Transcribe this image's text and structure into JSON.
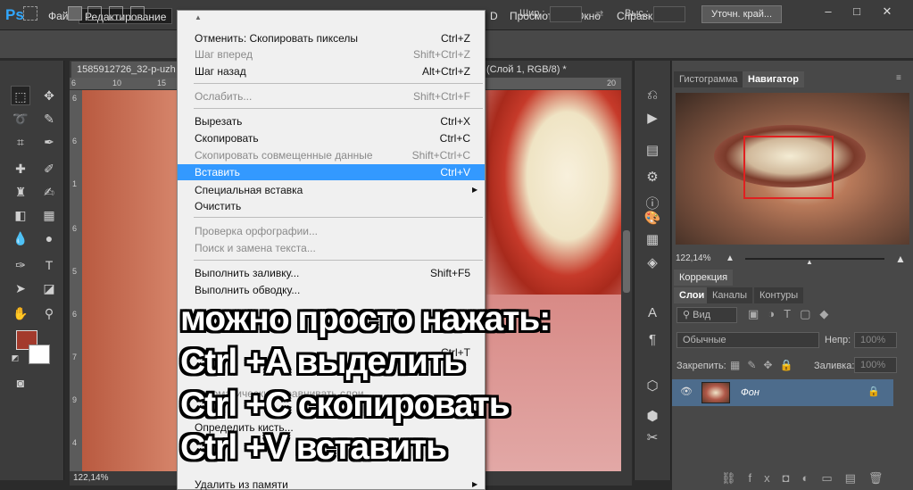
{
  "app": {
    "logo": "Ps",
    "accent": "#31a8ff"
  },
  "menubar": {
    "items": [
      "Файл",
      "Редактирование",
      "D",
      "Просмотр",
      "Окно",
      "Справка"
    ],
    "active": "Редактирование",
    "window_buttons": [
      "–",
      "□",
      "✕"
    ]
  },
  "options": {
    "width_label": "Шир.:",
    "height_label": "Выс.:",
    "refine_button": "Уточн. край..."
  },
  "document": {
    "tab_left": "1585912726_32-p-uzh",
    "tab_right": "(Слой 1, RGB/8) *",
    "ruler_h": [
      "6",
      "10",
      "15",
      "20"
    ],
    "ruler_v": [
      "6",
      "6",
      "1",
      "6",
      "5",
      "6",
      "7",
      "9",
      "4"
    ],
    "zoom": "122,14%"
  },
  "edit_menu": {
    "items": [
      {
        "label": "Отменить: Скопировать пикселы",
        "shortcut": "Ctrl+Z",
        "disabled": false
      },
      {
        "label": "Шаг вперед",
        "shortcut": "Shift+Ctrl+Z",
        "disabled": true
      },
      {
        "label": "Шаг назад",
        "shortcut": "Alt+Ctrl+Z",
        "disabled": false
      },
      {
        "label": "Ослабить...",
        "shortcut": "Shift+Ctrl+F",
        "disabled": true
      },
      {
        "label": "Вырезать",
        "shortcut": "Ctrl+X",
        "disabled": false
      },
      {
        "label": "Скопировать",
        "shortcut": "Ctrl+C",
        "disabled": false
      },
      {
        "label": "Скопировать совмещенные данные",
        "shortcut": "Shift+Ctrl+C",
        "disabled": true
      },
      {
        "label": "Вставить",
        "shortcut": "Ctrl+V",
        "disabled": false,
        "highlighted": true
      },
      {
        "label": "Специальная вставка",
        "shortcut": "",
        "disabled": false,
        "submenu": true
      },
      {
        "label": "Очистить",
        "shortcut": "",
        "disabled": false
      },
      {
        "label": "Проверка орфографии...",
        "shortcut": "",
        "disabled": true
      },
      {
        "label": "Поиск и замена текста...",
        "shortcut": "",
        "disabled": true
      },
      {
        "label": "Выполнить заливку...",
        "shortcut": "Shift+F5",
        "disabled": false
      },
      {
        "label": "Выполнить обводку...",
        "shortcut": "",
        "disabled": false
      },
      {
        "label": "Автоматически выравнивать слои...",
        "shortcut": "",
        "disabled": true
      },
      {
        "label": "Определить кисть...",
        "shortcut": "",
        "disabled": false
      },
      {
        "label": "Удалить из памяти",
        "shortcut": "",
        "disabled": false,
        "submenu": true
      }
    ],
    "partial_shortcut": "Ctrl+T"
  },
  "caption": {
    "line1": "можно просто нажать:",
    "line2": "Ctrl +A  выделить",
    "line3": "Ctrl +C  скопировать",
    "line4": "Ctrl +V  вставить"
  },
  "right_panels": {
    "top_tabs": [
      "Гистограмма",
      "Навигатор"
    ],
    "navigator_zoom": "122,14%",
    "correction_tab": "Коррекция",
    "layer_tabs": [
      "Слои",
      "Каналы",
      "Контуры"
    ],
    "kind_filter": "Вид",
    "blend_mode": "Обычные",
    "opacity_label": "Непр:",
    "opacity_value": "100%",
    "lock_label": "Закрепить:",
    "fill_label": "Заливка:",
    "fill_value": "100%",
    "layer_name": "Фон"
  },
  "colors": {
    "foreground": "#a33a2c",
    "background": "#ffffff",
    "highlight": "#3399ff",
    "nav_frame": "#e02020",
    "layer_selected": "#4d6c8c"
  }
}
